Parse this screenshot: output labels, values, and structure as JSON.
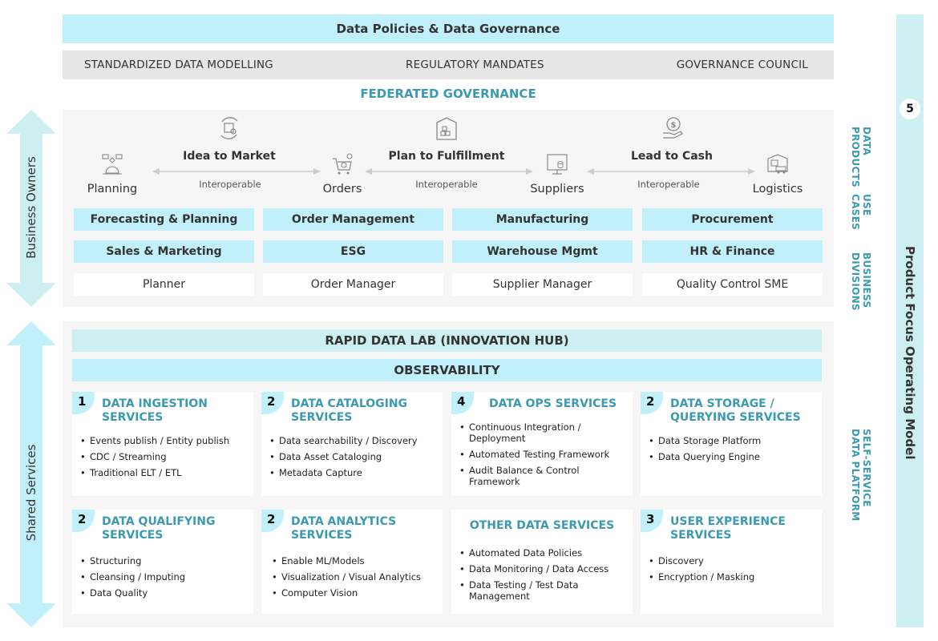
{
  "header": {
    "policies_title": "Data Policies & Data Governance",
    "pillars": [
      "STANDARDIZED DATA MODELLING",
      "REGULATORY MANDATES",
      "GOVERNANCE COUNCIL"
    ],
    "federated_title": "FEDERATED GOVERNANCE"
  },
  "side": {
    "business_owners": "Business Owners",
    "shared_services": "Shared Services"
  },
  "flow": {
    "nodes": [
      {
        "label": "Planning",
        "icon": "planning-flowchart-icon"
      },
      {
        "label": "Orders",
        "icon": "cart-gear-icon"
      },
      {
        "label": "Suppliers",
        "icon": "monitor-database-icon"
      },
      {
        "label": "Logistics",
        "icon": "warehouse-truck-icon"
      }
    ],
    "processes": [
      {
        "label": "Idea to Market",
        "icon": "cycle-box-gear-icon"
      },
      {
        "label": "Plan to Fulfillment",
        "icon": "warehouse-boxes-icon"
      },
      {
        "label": "Lead to Cash",
        "icon": "hand-dollar-icon"
      }
    ],
    "link_label": "Interoperable"
  },
  "grid": {
    "use_cases_row1": [
      "Forecasting & Planning",
      "Order Management",
      "Manufacturing",
      "Procurement"
    ],
    "use_cases_row2": [
      "Sales & Marketing",
      "ESG",
      "Warehouse Mgmt",
      "HR & Finance"
    ],
    "roles": [
      "Planner",
      "Order Manager",
      "Supplier Manager",
      "Quality Control SME"
    ]
  },
  "right_labels": {
    "data_products": [
      "DATA",
      "PRODUCTS"
    ],
    "use_cases": [
      "USE",
      "CASES"
    ],
    "business_divisions": [
      "BUSINESS",
      "DIVISIONS"
    ],
    "self_service": [
      "SELF-SERVICE",
      "DATA PLATFORM"
    ],
    "model_badge": "5",
    "model_title": "Product Focus Operating Model"
  },
  "shared": {
    "lab": "RAPID DATA LAB (INNOVATION HUB)",
    "observability": "OBSERVABILITY",
    "services": [
      {
        "count": "1",
        "title": "DATA INGESTION SERVICES",
        "items": [
          "Events publish / Entity publish",
          "CDC / Streaming",
          "Traditional ELT / ETL"
        ]
      },
      {
        "count": "2",
        "title": "DATA CATALOGING SERVICES",
        "items": [
          "Data searchability / Discovery",
          "Data Asset Cataloging",
          "Metadata Capture"
        ]
      },
      {
        "count": "4",
        "title": "DATA OPS SERVICES",
        "items": [
          "Continuous Integration / Deployment",
          "Automated Testing Framework",
          "Audit Balance & Control Framework"
        ]
      },
      {
        "count": "2",
        "title": "DATA STORAGE / QUERYING SERVICES",
        "items": [
          "Data Storage Platform",
          "Data Querying Engine"
        ]
      },
      {
        "count": "2",
        "title": "DATA QUALIFYING SERVICES",
        "items": [
          "Structuring",
          "Cleansing / Imputing",
          "Data Quality"
        ]
      },
      {
        "count": "2",
        "title": "DATA ANALYTICS SERVICES",
        "items": [
          "Enable ML/Models",
          "Visualization / Visual Analytics",
          "Computer Vision"
        ]
      },
      {
        "count": "",
        "title": "OTHER DATA SERVICES",
        "items": [
          "Automated Data Policies",
          "Data Monitoring / Data Access",
          "Data Testing / Test Data Management"
        ]
      },
      {
        "count": "3",
        "title": "USER EXPERIENCE SERVICES",
        "items": [
          "Discovery",
          "Encryption / Masking"
        ]
      }
    ]
  },
  "colors": {
    "accent_teal": "#3b9ab0",
    "light_blue": "#c1f0fb",
    "mint": "#cdeff2",
    "gray_band": "#e6e6e6",
    "panel_bg": "#f6f6f6"
  }
}
